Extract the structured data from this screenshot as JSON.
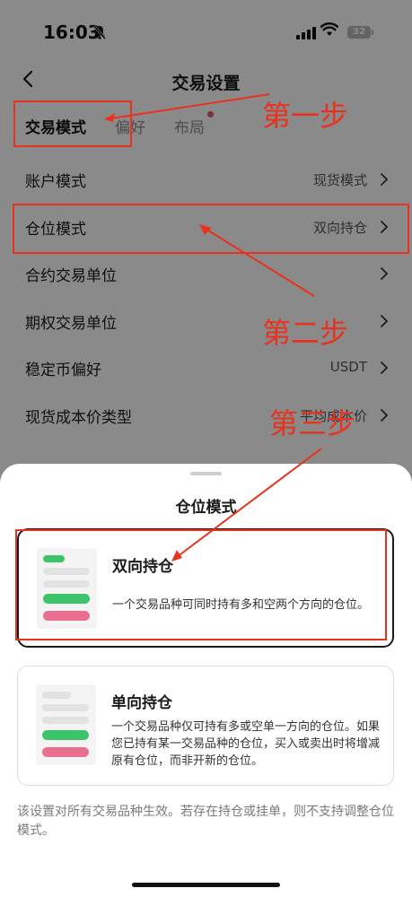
{
  "status": {
    "time": "16:03",
    "battery": "32"
  },
  "header": {
    "title": "交易设置"
  },
  "tabs": [
    {
      "label": "交易模式"
    },
    {
      "label": "偏好"
    },
    {
      "label": "布局"
    }
  ],
  "settings": [
    {
      "label": "账户模式",
      "value": "现货模式"
    },
    {
      "label": "仓位模式",
      "value": "双向持仓"
    },
    {
      "label": "合约交易单位",
      "value": ""
    },
    {
      "label": "期权交易单位",
      "value": ""
    },
    {
      "label": "稳定币偏好",
      "value": "USDT"
    },
    {
      "label": "现货成本价类型",
      "value": "平均成本价"
    }
  ],
  "sheet": {
    "title": "仓位模式",
    "options": [
      {
        "title": "双向持仓",
        "desc": "一个交易品种可同时持有多和空两个方向的仓位。",
        "selected": true
      },
      {
        "title": "单向持仓",
        "desc": "一个交易品种仅可持有多或空单一方向的仓位。如果您已持有某一交易品种的仓位，买入或卖出时将增减原有仓位，而非开新的仓位。",
        "selected": false
      }
    ],
    "footnote": "该设置对所有交易品种生效。若存在持仓或挂单，则不支持调整仓位模式。"
  },
  "annotations": {
    "color": "#e8321e",
    "step1": "第一步",
    "step2": "第二步",
    "step3": "第三步"
  }
}
